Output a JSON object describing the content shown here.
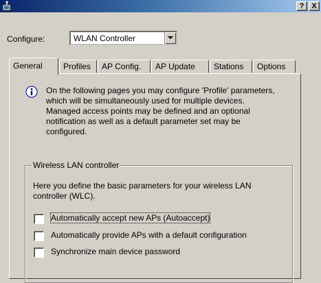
{
  "titlebar": {
    "help_label": "?",
    "close_label": "X"
  },
  "configure": {
    "label": "Configure:",
    "value": "WLAN Controller"
  },
  "tabs": [
    {
      "label": "General"
    },
    {
      "label": "Profiles"
    },
    {
      "label": "AP Config."
    },
    {
      "label": "AP Update"
    },
    {
      "label": "Stations"
    },
    {
      "label": "Options"
    }
  ],
  "info": {
    "lines": [
      "On the following pages you may configure 'Profile' parameters,",
      "which will be simultaneously used for multiple devices.",
      "Managed access points may be defined and an optional",
      "notification as well as a default parameter set may be",
      "configured."
    ]
  },
  "group": {
    "title": "Wireless LAN controller",
    "desc_lines": [
      "Here you define the basic parameters for your wireless LAN",
      "controller (WLC)."
    ],
    "checkboxes": [
      {
        "label": "Automatically accept new APs (Autoaccept)",
        "checked": false
      },
      {
        "label": "Automatically provide APs with a default configuration",
        "checked": false
      },
      {
        "label": "Synchronize main device password",
        "checked": false
      }
    ]
  },
  "colors": {
    "title_bar": "#0a246a",
    "dialog_face": "#d4d0c8"
  }
}
